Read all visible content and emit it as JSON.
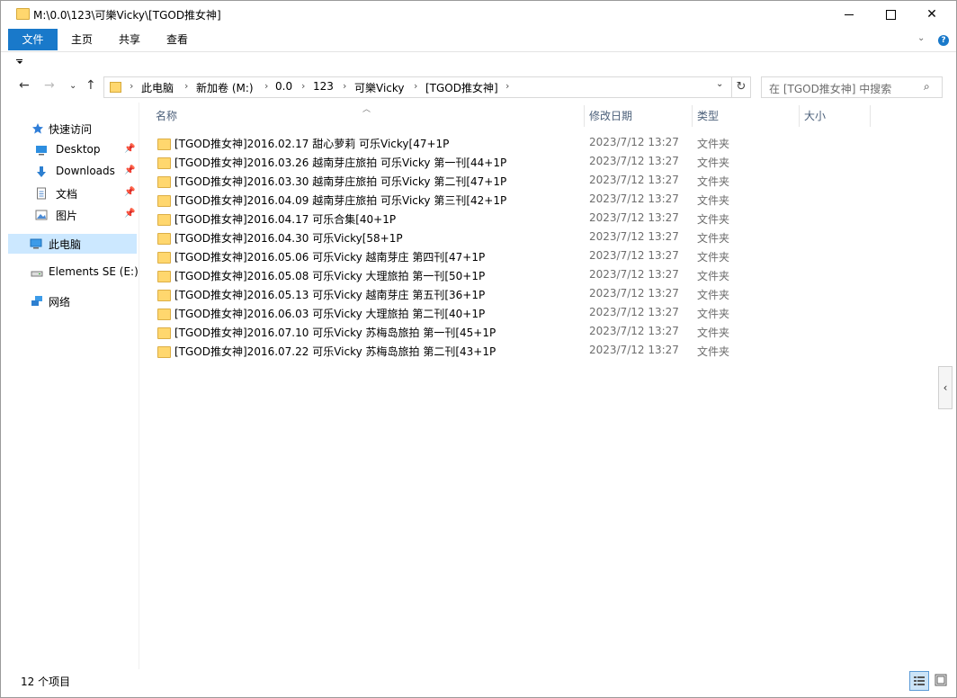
{
  "window": {
    "title": "M:\\0.0\\123\\可樂Vicky\\[TGOD推女神]",
    "minimize_glyph": "—",
    "close_glyph": "✕"
  },
  "ribbon": {
    "tabs": [
      "文件",
      "主页",
      "共享",
      "查看"
    ],
    "help_glyph": "?"
  },
  "nav": {
    "back_glyph": "←",
    "forward_glyph": "→",
    "recent_glyph": "⌄",
    "up_glyph": "↑",
    "breadcrumbs": [
      "此电脑",
      "新加卷 (M:)",
      "0.0",
      "123",
      "可樂Vicky",
      "[TGOD推女神]"
    ],
    "refresh_glyph": "↻",
    "search_placeholder": "在 [TGOD推女神] 中搜索"
  },
  "sidebar": {
    "items": [
      {
        "label": "快速访问",
        "icon": "star-icon",
        "pinned": false
      },
      {
        "label": "Desktop",
        "icon": "desktop-icon",
        "pinned": true
      },
      {
        "label": "Downloads",
        "icon": "downloads-icon",
        "pinned": true
      },
      {
        "label": "文档",
        "icon": "documents-icon",
        "pinned": true
      },
      {
        "label": "图片",
        "icon": "pictures-icon",
        "pinned": true
      },
      {
        "label": "此电脑",
        "icon": "computer-icon",
        "pinned": false,
        "selected": true
      },
      {
        "label": "Elements SE (E:)",
        "icon": "drive-icon",
        "pinned": false
      },
      {
        "label": "网络",
        "icon": "network-icon",
        "pinned": false
      }
    ]
  },
  "columns": {
    "name": "名称",
    "date": "修改日期",
    "type": "类型",
    "size": "大小"
  },
  "files": [
    {
      "name": "[TGOD推女神]2016.02.17 甜心萝莉 可乐Vicky[47+1P",
      "date": "2023/7/12 13:27",
      "type": "文件夹"
    },
    {
      "name": "[TGOD推女神]2016.03.26 越南芽庄旅拍 可乐Vicky 第一刊[44+1P",
      "date": "2023/7/12 13:27",
      "type": "文件夹"
    },
    {
      "name": "[TGOD推女神]2016.03.30 越南芽庄旅拍 可乐Vicky 第二刊[47+1P",
      "date": "2023/7/12 13:27",
      "type": "文件夹"
    },
    {
      "name": "[TGOD推女神]2016.04.09 越南芽庄旅拍 可乐Vicky 第三刊[42+1P",
      "date": "2023/7/12 13:27",
      "type": "文件夹"
    },
    {
      "name": "[TGOD推女神]2016.04.17 可乐合集[40+1P",
      "date": "2023/7/12 13:27",
      "type": "文件夹"
    },
    {
      "name": "[TGOD推女神]2016.04.30 可乐Vicky[58+1P",
      "date": "2023/7/12 13:27",
      "type": "文件夹"
    },
    {
      "name": "[TGOD推女神]2016.05.06 可乐Vicky 越南芽庄 第四刊[47+1P",
      "date": "2023/7/12 13:27",
      "type": "文件夹"
    },
    {
      "name": "[TGOD推女神]2016.05.08 可乐Vicky 大理旅拍 第一刊[50+1P",
      "date": "2023/7/12 13:27",
      "type": "文件夹"
    },
    {
      "name": "[TGOD推女神]2016.05.13 可乐Vicky 越南芽庄 第五刊[36+1P",
      "date": "2023/7/12 13:27",
      "type": "文件夹"
    },
    {
      "name": "[TGOD推女神]2016.06.03 可乐Vicky 大理旅拍 第二刊[40+1P",
      "date": "2023/7/12 13:27",
      "type": "文件夹"
    },
    {
      "name": "[TGOD推女神]2016.07.10 可乐Vicky 苏梅岛旅拍 第一刊[45+1P",
      "date": "2023/7/12 13:27",
      "type": "文件夹"
    },
    {
      "name": "[TGOD推女神]2016.07.22 可乐Vicky 苏梅岛旅拍 第二刊[43+1P",
      "date": "2023/7/12 13:27",
      "type": "文件夹"
    }
  ],
  "status": {
    "item_count": "12 个项目"
  },
  "colors": {
    "accent": "#1979ca",
    "selected_bg": "#cce8ff",
    "folder": "#ffd76e"
  }
}
